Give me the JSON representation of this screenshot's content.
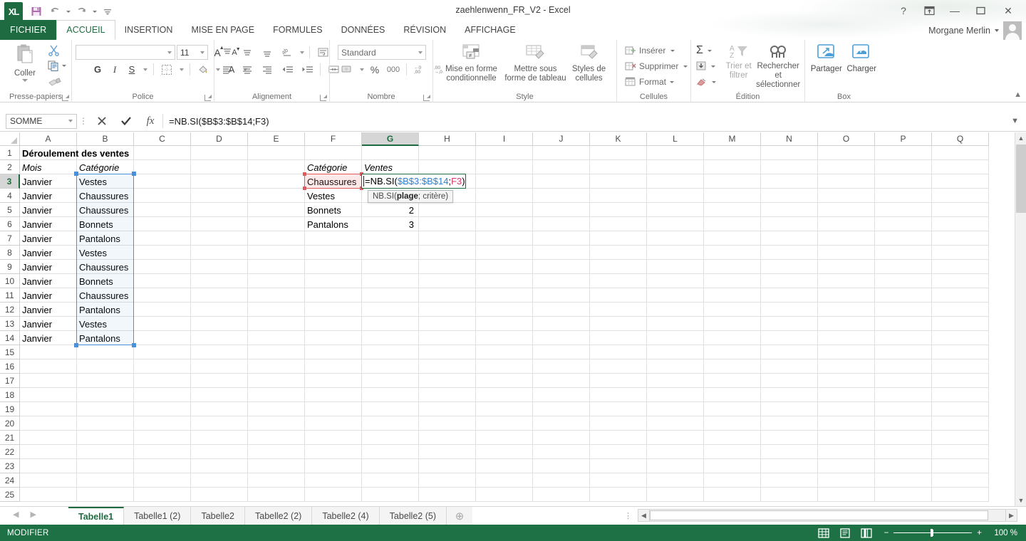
{
  "window": {
    "title": "zaehlenwenn_FR_V2 - Excel",
    "user_name": "Morgane Merlin",
    "help_icon": "?",
    "ribbon_display_icon": "ribbon-display-options-icon",
    "minimize_icon": "—",
    "restore_icon": "❐",
    "close_icon": "✕"
  },
  "quick_access": {
    "logo": "XL",
    "save": "save-icon",
    "undo": "undo-icon",
    "redo": "redo-icon",
    "customize": "customize-icon"
  },
  "ribbon": {
    "tabs": [
      {
        "label": "FICHIER",
        "active": false,
        "file": true
      },
      {
        "label": "ACCUEIL",
        "active": true
      },
      {
        "label": "INSERTION",
        "active": false
      },
      {
        "label": "MISE EN PAGE",
        "active": false
      },
      {
        "label": "FORMULES",
        "active": false
      },
      {
        "label": "DONNÉES",
        "active": false
      },
      {
        "label": "RÉVISION",
        "active": false
      },
      {
        "label": "AFFICHAGE",
        "active": false
      }
    ],
    "groups": {
      "clipboard": {
        "label": "Presse-papiers",
        "paste": "Coller",
        "cut": "cut-icon",
        "copy": "copy-icon",
        "format_painter": "format-painter-icon"
      },
      "font": {
        "label": "Police",
        "font_name": "",
        "font_name_placeholder": "",
        "font_size": "11",
        "grow_font": "A",
        "shrink_font": "A",
        "bold": "G",
        "italic": "I",
        "underline": "S",
        "borders": "borders-icon",
        "fill_color": "fill-color-icon",
        "font_color": "A"
      },
      "alignment": {
        "label": "Alignement",
        "align_top": "align-top-icon",
        "align_middle": "align-middle-icon",
        "align_bottom": "align-bottom-icon",
        "orientation": "orientation-icon",
        "align_left": "align-left-icon",
        "align_center": "align-center-icon",
        "align_right": "align-right-icon",
        "decrease_indent": "decrease-indent-icon",
        "increase_indent": "increase-indent-icon",
        "wrap_text": "wrap-text-icon",
        "merge_cells": "merge-cells-icon"
      },
      "number": {
        "label": "Nombre",
        "format": "Standard",
        "currency": "currency-icon",
        "percent": "%",
        "thousands": "000",
        "increase_decimal": "increase-decimal-icon",
        "decrease_decimal": "decrease-decimal-icon"
      },
      "styles": {
        "label": "Style",
        "conditional": "Mise en forme conditionnelle",
        "table": "Mettre sous forme de tableau",
        "cell_styles": "Styles de cellules"
      },
      "cells": {
        "label": "Cellules",
        "insert": "Insérer",
        "delete": "Supprimer",
        "format": "Format"
      },
      "editing": {
        "label": "Édition",
        "autosum": "Σ",
        "fill": "fill-icon",
        "clear": "clear-icon",
        "sort_filter": "Trier et filtrer",
        "find_select": "Rechercher et sélectionner"
      },
      "box": {
        "label": "Box",
        "share": "Partager",
        "load": "Charger"
      }
    },
    "collapse_icon": "▲"
  },
  "formula_bar": {
    "name_box": "SOMME",
    "cancel_icon": "✕",
    "enter_icon": "✔",
    "insert_function_icon": "fx",
    "formula": "=NB.SI($B$3:$B$14;F3)",
    "expand_icon": "▼"
  },
  "grid": {
    "columns": [
      "A",
      "B",
      "C",
      "D",
      "E",
      "F",
      "G",
      "H",
      "I",
      "J",
      "K",
      "L",
      "M",
      "N",
      "O",
      "P",
      "Q"
    ],
    "selected_column": "G",
    "rows": [
      1,
      2,
      3,
      4,
      5,
      6,
      7,
      8,
      9,
      10,
      11,
      12,
      13,
      14,
      15,
      16,
      17,
      18,
      19,
      20,
      21,
      22,
      23,
      24,
      25
    ],
    "selected_row": 3,
    "cells": [
      {
        "ref": "A1",
        "col": 0,
        "row": 1,
        "value": "Déroulement des ventes",
        "style": "bold"
      },
      {
        "ref": "A2",
        "col": 0,
        "row": 2,
        "value": "Mois",
        "style": "ital"
      },
      {
        "ref": "B2",
        "col": 1,
        "row": 2,
        "value": "Catégorie",
        "style": "ital"
      },
      {
        "ref": "A3",
        "col": 0,
        "row": 3,
        "value": "Janvier",
        "style": ""
      },
      {
        "ref": "B3",
        "col": 1,
        "row": 3,
        "value": "Vestes",
        "style": ""
      },
      {
        "ref": "A4",
        "col": 0,
        "row": 4,
        "value": "Janvier",
        "style": ""
      },
      {
        "ref": "B4",
        "col": 1,
        "row": 4,
        "value": "Chaussures",
        "style": ""
      },
      {
        "ref": "A5",
        "col": 0,
        "row": 5,
        "value": "Janvier",
        "style": ""
      },
      {
        "ref": "B5",
        "col": 1,
        "row": 5,
        "value": "Chaussures",
        "style": ""
      },
      {
        "ref": "A6",
        "col": 0,
        "row": 6,
        "value": "Janvier",
        "style": ""
      },
      {
        "ref": "B6",
        "col": 1,
        "row": 6,
        "value": "Bonnets",
        "style": ""
      },
      {
        "ref": "A7",
        "col": 0,
        "row": 7,
        "value": "Janvier",
        "style": ""
      },
      {
        "ref": "B7",
        "col": 1,
        "row": 7,
        "value": "Pantalons",
        "style": ""
      },
      {
        "ref": "A8",
        "col": 0,
        "row": 8,
        "value": "Janvier",
        "style": ""
      },
      {
        "ref": "B8",
        "col": 1,
        "row": 8,
        "value": "Vestes",
        "style": ""
      },
      {
        "ref": "A9",
        "col": 0,
        "row": 9,
        "value": "Janvier",
        "style": ""
      },
      {
        "ref": "B9",
        "col": 1,
        "row": 9,
        "value": "Chaussures",
        "style": ""
      },
      {
        "ref": "A10",
        "col": 0,
        "row": 10,
        "value": "Janvier",
        "style": ""
      },
      {
        "ref": "B10",
        "col": 1,
        "row": 10,
        "value": "Bonnets",
        "style": ""
      },
      {
        "ref": "A11",
        "col": 0,
        "row": 11,
        "value": "Janvier",
        "style": ""
      },
      {
        "ref": "B11",
        "col": 1,
        "row": 11,
        "value": "Chaussures",
        "style": ""
      },
      {
        "ref": "A12",
        "col": 0,
        "row": 12,
        "value": "Janvier",
        "style": ""
      },
      {
        "ref": "B12",
        "col": 1,
        "row": 12,
        "value": "Pantalons",
        "style": ""
      },
      {
        "ref": "A13",
        "col": 0,
        "row": 13,
        "value": "Janvier",
        "style": ""
      },
      {
        "ref": "B13",
        "col": 1,
        "row": 13,
        "value": "Vestes",
        "style": ""
      },
      {
        "ref": "A14",
        "col": 0,
        "row": 14,
        "value": "Janvier",
        "style": ""
      },
      {
        "ref": "B14",
        "col": 1,
        "row": 14,
        "value": "Pantalons",
        "style": ""
      },
      {
        "ref": "F2",
        "col": 5,
        "row": 2,
        "value": "Catégorie",
        "style": "ital"
      },
      {
        "ref": "G2",
        "col": 6,
        "row": 2,
        "value": "Ventes",
        "style": "ital"
      },
      {
        "ref": "F3",
        "col": 5,
        "row": 3,
        "value": "Chaussures",
        "style": ""
      },
      {
        "ref": "F4",
        "col": 5,
        "row": 4,
        "value": "Vestes",
        "style": ""
      },
      {
        "ref": "F5",
        "col": 5,
        "row": 5,
        "value": "Bonnets",
        "style": ""
      },
      {
        "ref": "G5",
        "col": 6,
        "row": 5,
        "value": "2",
        "style": "num"
      },
      {
        "ref": "F6",
        "col": 5,
        "row": 6,
        "value": "Pantalons",
        "style": ""
      },
      {
        "ref": "G6",
        "col": 6,
        "row": 6,
        "value": "3",
        "style": "num"
      }
    ],
    "editing_cell": {
      "ref": "G3",
      "parts": [
        {
          "text": "=NB.SI(",
          "color": "black"
        },
        {
          "text": "$B$3:$B$14",
          "color": "blue"
        },
        {
          "text": ";",
          "color": "black"
        },
        {
          "text": "F3",
          "color": "red"
        },
        {
          "text": ")",
          "color": "black"
        }
      ]
    },
    "tooltip": {
      "prefix": "NB.SI(",
      "arg1": "plage",
      "sep": "; ",
      "arg2": "critère",
      "suffix": ")"
    },
    "range_highlight": {
      "ref": "$B$3:$B$14",
      "color": "#4a90d9"
    },
    "criterion_highlight": {
      "ref": "F3",
      "color": "#e05b5b"
    }
  },
  "sheet_tabs": {
    "prev_icon": "◀",
    "next_icon": "▶",
    "tabs": [
      {
        "label": "Tabelle1",
        "active": true
      },
      {
        "label": "Tabelle1 (2)",
        "active": false
      },
      {
        "label": "Tabelle2",
        "active": false
      },
      {
        "label": "Tabelle2 (2)",
        "active": false
      },
      {
        "label": "Tabelle2 (4)",
        "active": false
      },
      {
        "label": "Tabelle2 (5)",
        "active": false
      }
    ],
    "add_icon": "⊕"
  },
  "status_bar": {
    "mode": "MODIFIER",
    "view_normal": "normal-view-icon",
    "view_layout": "page-layout-icon",
    "view_break": "page-break-icon",
    "zoom_out": "−",
    "zoom_in": "+",
    "zoom_level": "100 %"
  },
  "colors": {
    "accent_green": "#1e7145",
    "file_tab_green": "#1e6b41",
    "range_blue": "#4a90d9",
    "criterion_red": "#e05b5b",
    "formula_blue": "#2f7fd0",
    "formula_red": "#d2376b"
  }
}
